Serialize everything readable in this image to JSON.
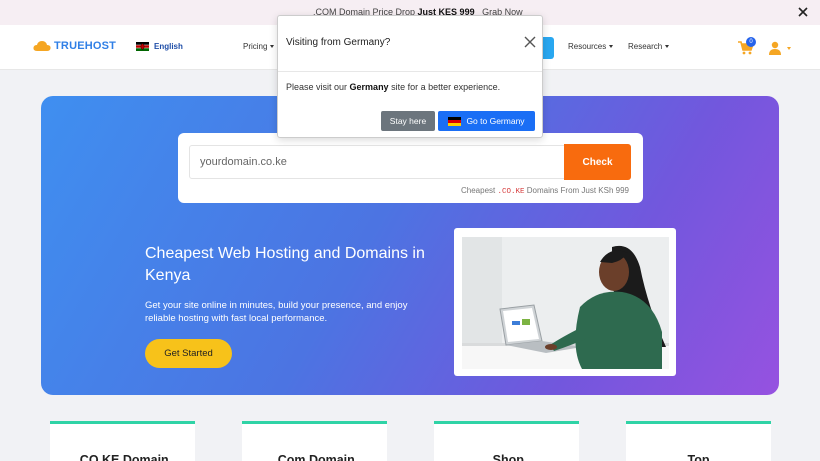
{
  "promo": {
    "text_before": ".COM Domain Price Drop",
    "price": "Just KES 999",
    "cta": "Grab Now"
  },
  "nav": {
    "brand": "TRUEHOST",
    "language": "English",
    "pricing": "Pricing",
    "resources": "Resources",
    "research": "Research",
    "cart_count": "0"
  },
  "hero": {
    "search_placeholder": "yourdomain.co.ke",
    "check_label": "Check",
    "note_prefix": "Cheapest",
    "note_tld": ".CO.KE",
    "note_suffix": "Domains From Just KSh 999",
    "title": "Cheapest Web Hosting and Domains in Kenya",
    "subtitle": "Get your site online in minutes, build your presence, and enjoy reliable hosting with fast local performance.",
    "cta": "Get Started"
  },
  "cards": [
    {
      "title": ".CO.KE Domain"
    },
    {
      "title": ".Com Domain"
    },
    {
      "title": ".Shop"
    },
    {
      "title": "Top"
    }
  ],
  "modal": {
    "title": "Visiting from Germany?",
    "body_before": "Please visit our",
    "body_country": "Germany",
    "body_after": "site for a better experience.",
    "stay_label": "Stay here",
    "go_label": "Go to Germany"
  },
  "colors": {
    "accent_orange": "#f86b0e",
    "brand_blue": "#2f7fe6",
    "cta_yellow": "#f7c21a",
    "card_accent": "#2fd3a6"
  }
}
